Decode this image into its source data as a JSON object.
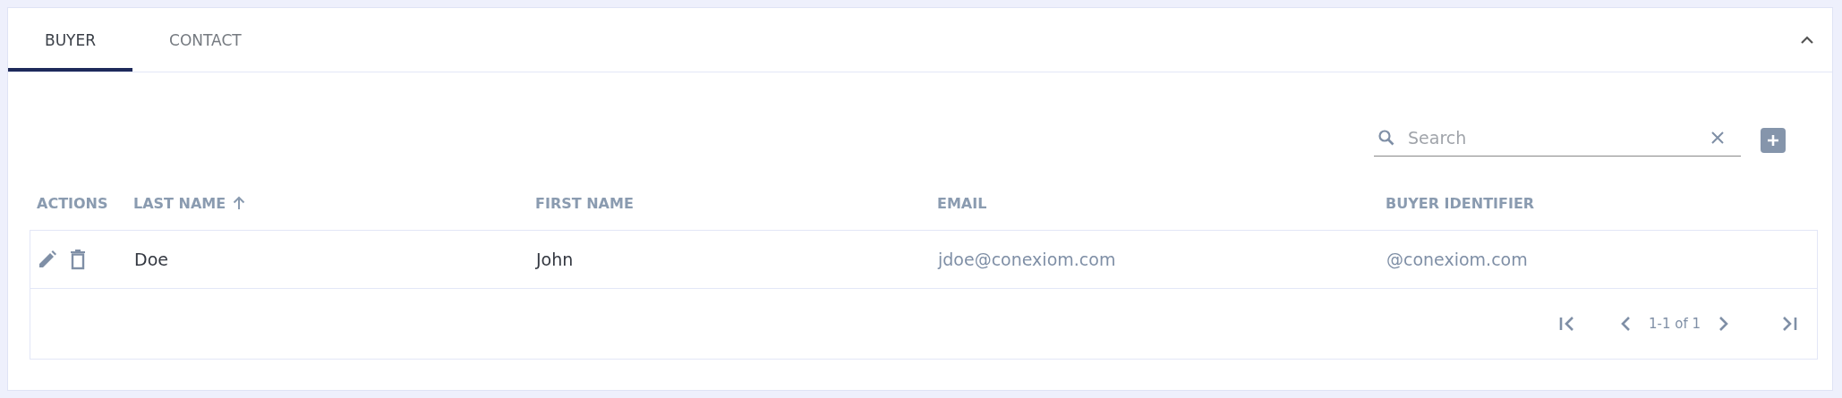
{
  "tabs": [
    {
      "label": "BUYER",
      "selected": true
    },
    {
      "label": "CONTACT",
      "selected": false
    }
  ],
  "search": {
    "placeholder": "Search"
  },
  "table": {
    "columns": [
      {
        "label": "ACTIONS",
        "sorted": false
      },
      {
        "label": "LAST NAME",
        "sorted": true
      },
      {
        "label": "FIRST NAME",
        "sorted": false
      },
      {
        "label": "EMAIL",
        "sorted": false
      },
      {
        "label": "BUYER IDENTIFIER",
        "sorted": false
      }
    ],
    "rows": [
      {
        "last_name": "Doe",
        "first_name": "John",
        "email": "jdoe@conexiom.com",
        "buyer_identifier": "@conexiom.com"
      }
    ]
  },
  "pagination": {
    "range": "1-1 of 1"
  }
}
